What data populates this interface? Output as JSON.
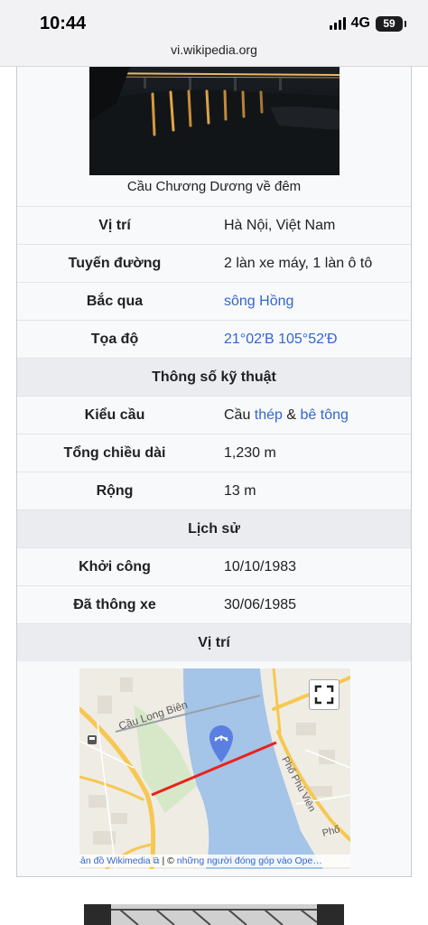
{
  "status_bar": {
    "time": "10:44",
    "network": "4G",
    "battery": "59"
  },
  "browser": {
    "url": "vi.wikipedia.org"
  },
  "infobox": {
    "caption": "Cầu Chương Dương về đêm",
    "rows": [
      {
        "label": "Vị trí",
        "value": "Hà Nội, Việt Nam"
      },
      {
        "label": "Tuyến đường",
        "value": "2 làn xe máy, 1 làn ô tô"
      },
      {
        "label": "Bắc qua",
        "link": "sông Hồng"
      },
      {
        "label": "Tọa độ",
        "link": "21°02′B 105°52′Đ"
      }
    ],
    "section_specs": "Thông số kỹ thuật",
    "specs": {
      "type_label": "Kiểu cầu",
      "type_prefix": "Cầu ",
      "type_link1": "thép",
      "type_sep": " & ",
      "type_link2": "bê tông",
      "length_label": "Tổng chiều dài",
      "length_value": "1,230 m",
      "width_label": "Rộng",
      "width_value": "13 m"
    },
    "section_history": "Lịch sử",
    "history": [
      {
        "label": "Khởi công",
        "value": "10/10/1983"
      },
      {
        "label": "Đã thông xe",
        "value": "30/06/1985"
      }
    ],
    "section_location": "Vị trí",
    "map": {
      "labels": {
        "bridge": "Cầu Long Biên",
        "street1": "Phố Phú Viên",
        "street2": "Phố"
      },
      "attribution_link": "Bản đồ Wikimedia",
      "attribution_text": " | © ",
      "attribution_link2": "những người đóng góp vào Ope…",
      "colors": {
        "water": "#a4c4e8",
        "land": "#efece4",
        "road": "#f6c851",
        "route": "#e8231b",
        "marker": "#5b7fe0"
      }
    }
  }
}
